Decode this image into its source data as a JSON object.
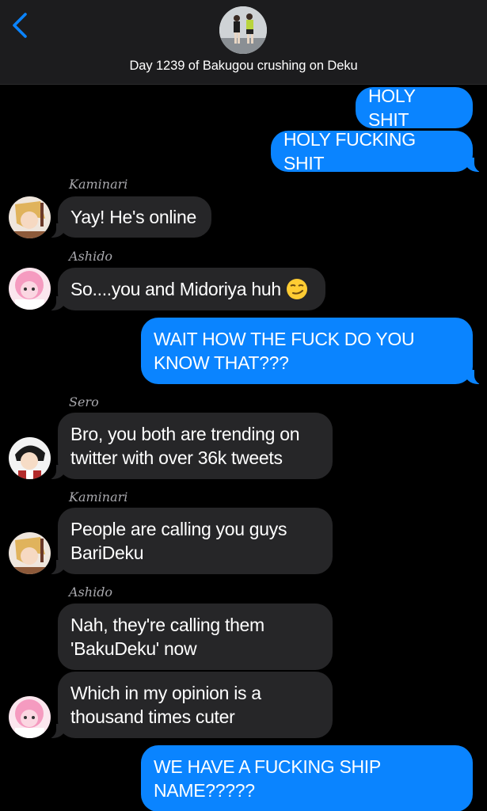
{
  "header": {
    "title": "Day 1239 of Bakugou crushing on Deku",
    "back_icon": "chevron-left-icon",
    "accent": "#0a84ff"
  },
  "messages": [
    {
      "dir": "out",
      "text": "HOLY SHIT"
    },
    {
      "dir": "out",
      "text": "HOLY FUCKING SHIT"
    },
    {
      "dir": "in",
      "sender": "Kaminari",
      "text": "Yay! He's online"
    },
    {
      "dir": "in",
      "sender": "Ashido",
      "text": "So....you and Midoriya huh",
      "emoji": "smirking-face"
    },
    {
      "dir": "out",
      "text": "WAIT HOW THE FUCK DO YOU KNOW THAT???"
    },
    {
      "dir": "in",
      "sender": "Sero",
      "text": "Bro, you both are trending on twitter with over 36k tweets"
    },
    {
      "dir": "in",
      "sender": "Kaminari",
      "text": "People are calling you guys BariDeku"
    },
    {
      "dir": "in",
      "sender": "Ashido",
      "text": "Nah, they're calling them 'BakuDeku' now"
    },
    {
      "dir": "in",
      "text": "Which in my opinion is a thousand times cuter"
    },
    {
      "dir": "out",
      "text": "WE HAVE A FUCKING SHIP NAME?????"
    }
  ],
  "colors": {
    "outgoing_bubble": "#0a84ff",
    "incoming_bubble": "#262628",
    "background": "#000000",
    "header_bg": "#1c1c1e"
  }
}
